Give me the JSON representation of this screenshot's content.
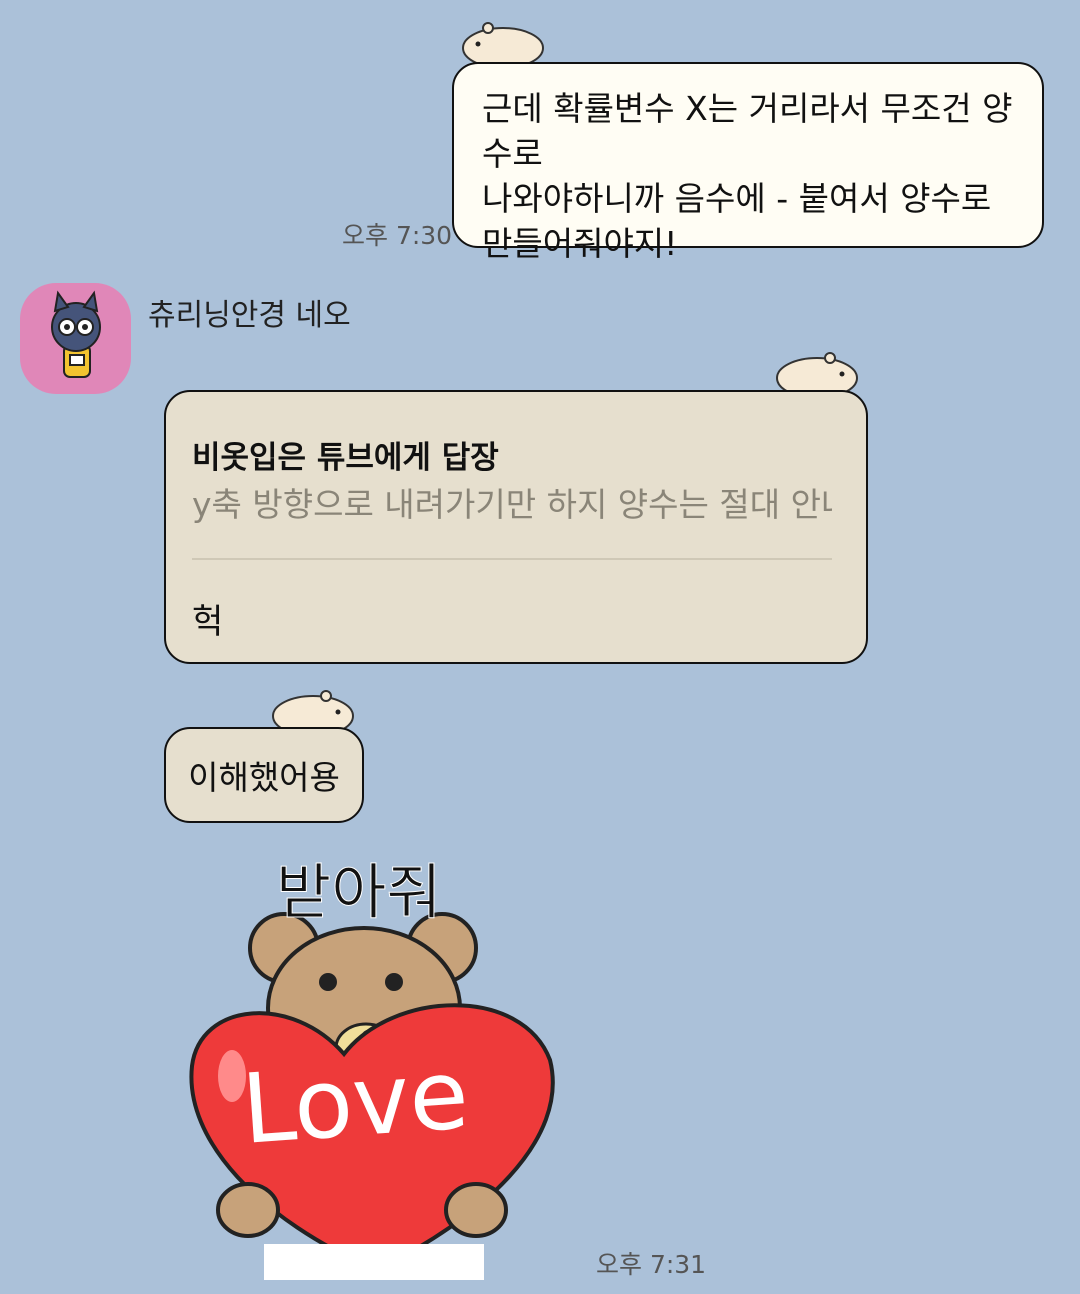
{
  "messages": {
    "sent": {
      "text_line1": "근데 확률변수 X는 거리라서 무조건 양수로",
      "text_line2": "나와야하니까 음수에 - 붙여서 양수로",
      "text_line3": "만들어줘야지!",
      "time": "오후 7:30"
    },
    "sender": {
      "name": "츄리닝안경 네오"
    },
    "reply": {
      "header": "비옷입은 튜브에게 답장",
      "quote": "y축 방향으로 내려가기만 하지 양수는 절대 안나…",
      "text": "헉"
    },
    "short": {
      "text": "이해했어용"
    },
    "sticker": {
      "caption": "받아줘",
      "heart_text": "Love",
      "time": "오후 7:31"
    }
  },
  "icons": [
    "hamster-icon",
    "avatar-icon"
  ],
  "colors": {
    "background": "#abc1d9",
    "sent_bubble": "#fffdf4",
    "received_bubble": "#e6dfce",
    "avatar_bg": "#e087b8",
    "heart": "#ee3a3a"
  }
}
